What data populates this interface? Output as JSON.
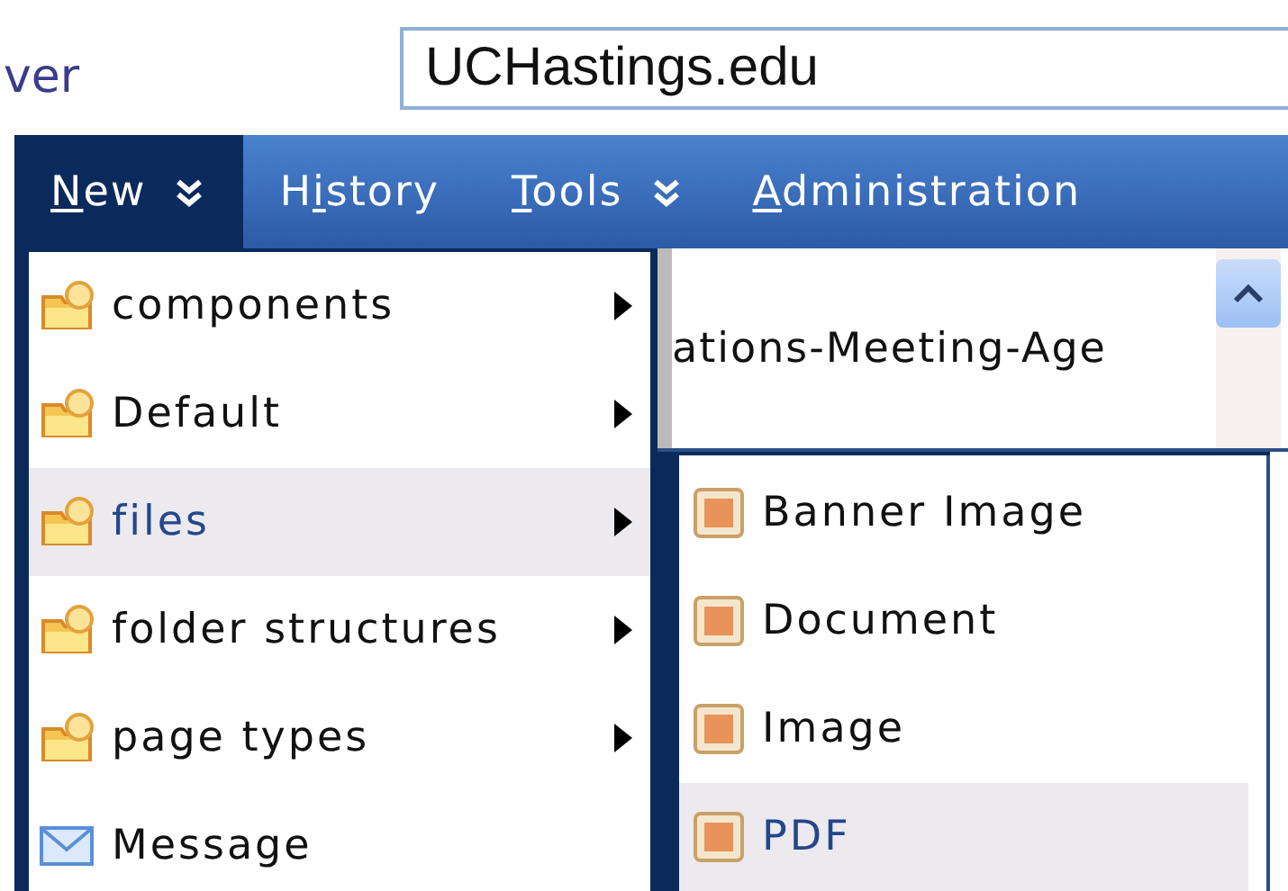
{
  "header": {
    "logo_text": "ver",
    "address": "UCHastings.edu"
  },
  "nav": [
    {
      "key": "N",
      "after": "ew",
      "dropdown": true,
      "selected": true
    },
    {
      "before": "H",
      "key": "i",
      "after": "story",
      "dropdown": false,
      "selected": false
    },
    {
      "key": "T",
      "after": "ools",
      "dropdown": true,
      "selected": false
    },
    {
      "key": "A",
      "after": "dministration",
      "dropdown": false,
      "selected": false
    }
  ],
  "menu": {
    "items": [
      {
        "label": "components",
        "kind": "folder",
        "submenu": true,
        "selected": false
      },
      {
        "label": "Default",
        "kind": "folder",
        "submenu": true,
        "selected": false
      },
      {
        "label": "files",
        "kind": "folder",
        "submenu": true,
        "selected": true
      },
      {
        "label": "folder structures",
        "kind": "folder",
        "submenu": true,
        "selected": false
      },
      {
        "label": "page types",
        "kind": "folder",
        "submenu": true,
        "selected": false
      },
      {
        "label": "Message",
        "kind": "message",
        "submenu": false,
        "selected": false
      }
    ]
  },
  "content": {
    "text": "ations-Meeting-Age"
  },
  "submenu": {
    "items": [
      {
        "label": "Banner Image",
        "selected": false
      },
      {
        "label": "Document",
        "selected": false
      },
      {
        "label": "Image",
        "selected": false
      },
      {
        "label": "PDF",
        "selected": true
      }
    ]
  }
}
